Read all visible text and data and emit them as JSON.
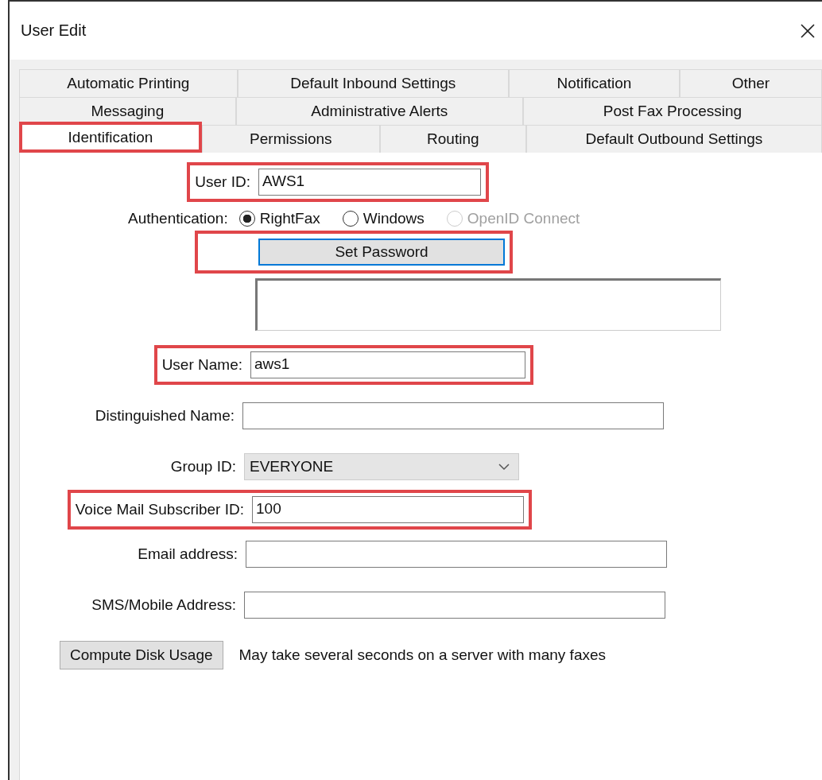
{
  "window": {
    "title": "User Edit"
  },
  "tab_rows": [
    [
      {
        "label": "Automatic Printing",
        "selected": false,
        "highlighted": false
      },
      {
        "label": "Default Inbound Settings",
        "selected": false,
        "highlighted": false
      },
      {
        "label": "Notification",
        "selected": false,
        "highlighted": false
      },
      {
        "label": "Other",
        "selected": false,
        "highlighted": false
      }
    ],
    [
      {
        "label": "Messaging",
        "selected": false,
        "highlighted": false
      },
      {
        "label": "Administrative Alerts",
        "selected": false,
        "highlighted": false
      },
      {
        "label": "Post Fax Processing",
        "selected": false,
        "highlighted": false
      }
    ],
    [
      {
        "label": "Identification",
        "selected": true,
        "highlighted": true
      },
      {
        "label": "Permissions",
        "selected": false,
        "highlighted": false
      },
      {
        "label": "Routing",
        "selected": false,
        "highlighted": false
      },
      {
        "label": "Default Outbound Settings",
        "selected": false,
        "highlighted": false
      }
    ]
  ],
  "form": [
    {
      "kind": "text",
      "label": "User ID:",
      "value": "AWS1",
      "highlighted": true
    },
    {
      "kind": "radio",
      "label": "Authentication:",
      "options": [
        {
          "label": "RightFax",
          "selected": true,
          "disabled": false
        },
        {
          "label": "Windows",
          "selected": false,
          "disabled": false
        },
        {
          "label": "OpenID Connect",
          "selected": false,
          "disabled": true
        }
      ]
    },
    {
      "kind": "button",
      "label": "Set Password",
      "focused": true,
      "highlighted": true
    },
    {
      "kind": "memo"
    },
    {
      "kind": "text",
      "label": "User Name:",
      "value": "aws1",
      "highlighted": true
    },
    {
      "kind": "text",
      "label": "Distinguished Name:",
      "highlighted": false
    },
    {
      "kind": "select",
      "label": "Group ID:",
      "value": "EVERYONE",
      "highlighted": false
    },
    {
      "kind": "text",
      "label": "Voice Mail Subscriber ID:",
      "value": "100",
      "highlighted": true
    },
    {
      "kind": "text",
      "label": "Email address:",
      "highlighted": false
    },
    {
      "kind": "text",
      "label": "SMS/Mobile Address:",
      "highlighted": false
    },
    {
      "kind": "action",
      "button": "Compute Disk Usage",
      "note": "May take several seconds on a server with many faxes"
    }
  ]
}
